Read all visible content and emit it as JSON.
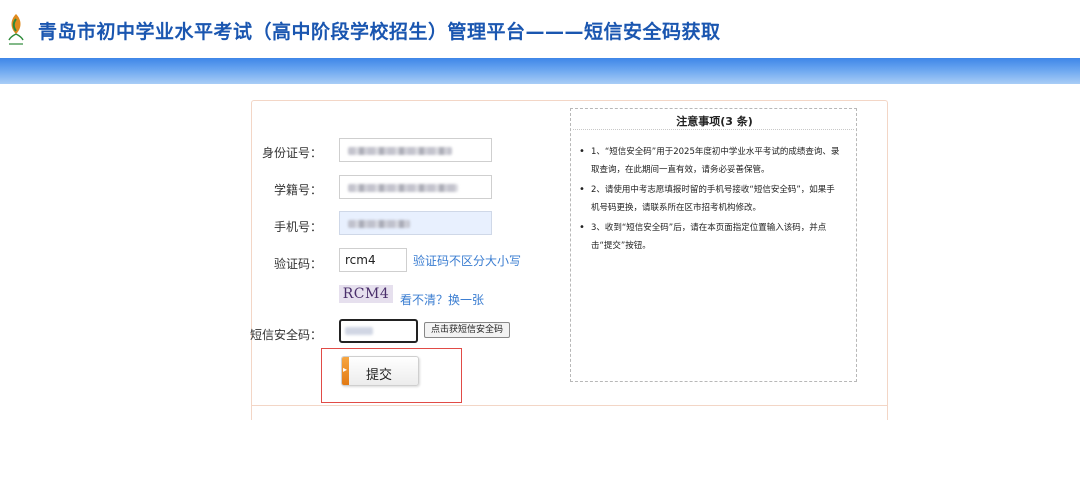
{
  "header": {
    "title": "青岛市初中学业水平考试（高中阶段学校招生）管理平台———短信安全码获取",
    "logo_icon": "leaf-logo-icon"
  },
  "form": {
    "id_label": "身份证号：",
    "student_no_label": "学籍号：",
    "phone_label": "手机号：",
    "captcha_label": "验证码：",
    "captcha_value": "rcm4",
    "captcha_hint": "验证码不区分大小写",
    "captcha_image_text": "RCM4",
    "refresh_link": "看不清？换一张",
    "sms_label": "短信安全码：",
    "sms_button": "点击获短信安全码",
    "submit_label": "提交"
  },
  "notice": {
    "title": "注意事项(3 条)",
    "items": [
      "1、“短信安全码”用于2025年度初中学业水平考试的成绩查询、录取查询，在此期间一直有效，请务必妥善保管。",
      "2、请使用中考志愿填报时留的手机号接收“短信安全码”，如果手机号码更换，请联系所在区市招考机构修改。",
      "3、收到“短信安全码”后，请在本页面指定位置输入该码，并点击“提交”按钮。"
    ]
  },
  "colors": {
    "title_blue": "#1a56b0",
    "link_blue": "#3a7dd1",
    "highlight_red": "#e14b46",
    "banner_blue": "#3e86e8"
  }
}
